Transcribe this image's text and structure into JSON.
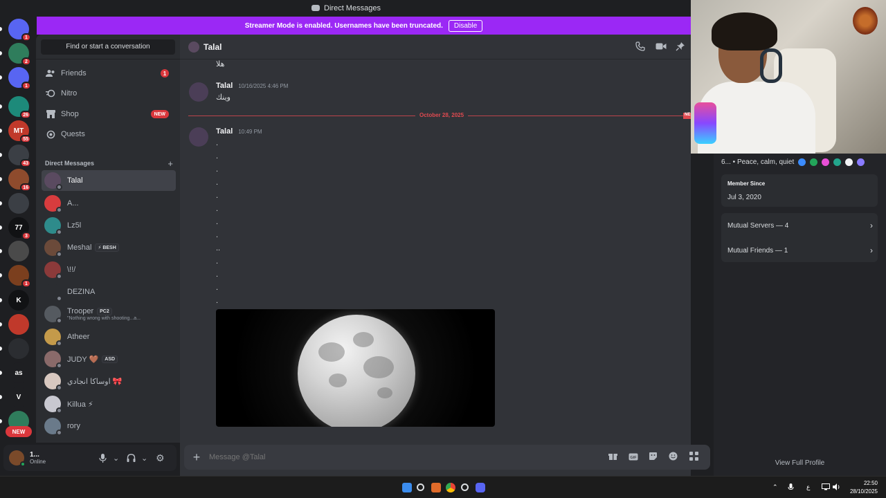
{
  "window": {
    "title": "Direct Messages"
  },
  "banner": {
    "message": "Streamer Mode is enabled. Usernames have been truncated.",
    "disable_label": "Disable"
  },
  "rail": {
    "servers": [
      {
        "label": "",
        "badge": "1",
        "color": "#5865f2",
        "icon": "discord-icon"
      },
      {
        "label": "",
        "badge": "2",
        "color": "#2f7d5c",
        "icon": "leaf-icon"
      },
      {
        "label": "",
        "badge": "1",
        "color": "#5865f2",
        "icon": "discord-icon"
      },
      {
        "label": "",
        "badge": "26",
        "color": "#1d8a7a",
        "icon": "globe-icon"
      },
      {
        "label": "MT",
        "badge": "55",
        "color": "#c0392b",
        "icon": ""
      },
      {
        "label": "",
        "badge": "43",
        "color": "#3b3f45",
        "icon": ""
      },
      {
        "label": "",
        "badge": "16",
        "color": "#8e4b2d",
        "icon": ""
      },
      {
        "label": "",
        "badge": "",
        "color": "#3b3f45",
        "icon": "x-icon"
      },
      {
        "label": "77",
        "badge": "3",
        "color": "#111214",
        "icon": ""
      },
      {
        "label": "",
        "badge": "",
        "color": "#4a4a4a",
        "icon": "spiral-icon"
      },
      {
        "label": "",
        "badge": "1",
        "color": "#7b3f1e",
        "icon": ""
      },
      {
        "label": "K",
        "badge": "",
        "color": "#111214",
        "icon": ""
      },
      {
        "label": "",
        "badge": "",
        "color": "#c0392b",
        "icon": ""
      },
      {
        "label": "",
        "badge": "",
        "color": "#2b2d31",
        "icon": ""
      },
      {
        "label": "as",
        "badge": "",
        "color": "#1e1f22",
        "icon": ""
      },
      {
        "label": "V",
        "badge": "",
        "color": "#1e1f22",
        "icon": ""
      },
      {
        "label": "",
        "badge": "",
        "color": "#2f7d5c",
        "icon": "leaf-icon"
      }
    ],
    "new_label": "NEW"
  },
  "sidebar": {
    "search_placeholder": "Find or start a conversation",
    "nav": [
      {
        "label": "Friends",
        "badge": "1",
        "icon": "friends-icon"
      },
      {
        "label": "Nitro",
        "badge": "",
        "icon": "nitro-icon"
      },
      {
        "label": "Shop",
        "badge": "NEW",
        "icon": "shop-icon"
      },
      {
        "label": "Quests",
        "badge": "",
        "icon": "quests-icon"
      }
    ],
    "dm_header": "Direct Messages",
    "dms": [
      {
        "name": "Talal",
        "sub": "",
        "tag": "",
        "color": "#5a4a60",
        "active": true
      },
      {
        "name": "A...",
        "sub": "",
        "tag": "",
        "color": "#d83c3e",
        "active": false
      },
      {
        "name": "Lz5l",
        "sub": "",
        "tag": "",
        "color": "#2e8b8b",
        "active": false
      },
      {
        "name": "Meshal",
        "sub": "",
        "tag": "⚡ BESH",
        "color": "#6b4a3a",
        "active": false
      },
      {
        "name": "\\!!/",
        "sub": "",
        "tag": "",
        "color": "#8b3a3a",
        "active": false
      },
      {
        "name": "DEZINA",
        "sub": "",
        "tag": "",
        "color": "#2b2d31",
        "active": false
      },
      {
        "name": "Trooper",
        "sub": "\"Nothing wrong with shooting...a...",
        "tag": "PC2",
        "color": "#555a60",
        "active": false
      },
      {
        "name": "Atheer",
        "sub": "",
        "tag": "",
        "color": "#c49a4a",
        "active": false
      },
      {
        "name": "JUDY 🤎",
        "sub": "",
        "tag": "ASD",
        "color": "#8a6a6a",
        "active": false
      },
      {
        "name": "اوساكا انجادي 🎀",
        "sub": "",
        "tag": "",
        "color": "#d8c8c0",
        "active": false
      },
      {
        "name": "Killua ⚡",
        "sub": "",
        "tag": "",
        "color": "#c8c8d0",
        "active": false
      },
      {
        "name": "rory",
        "sub": "",
        "tag": "",
        "color": "#6a7a8a",
        "active": false
      }
    ]
  },
  "user_panel": {
    "name": "1...",
    "status": "Online"
  },
  "chat": {
    "recipient": "Talal",
    "messages": [
      {
        "author": "Talal",
        "time": "10/16/2025 4:46 PM",
        "text": "وينك"
      }
    ],
    "prev_text": "هلا",
    "divider_date": "October 28, 2025",
    "divider_new": "NE",
    "last_author": "Talal",
    "last_time": "10:49 PM",
    "dots": [
      ".",
      ".",
      ".",
      ".",
      ".",
      ".",
      ".",
      ".",
      "..",
      ".",
      ".",
      ".",
      "."
    ],
    "composer_placeholder": "Message @Talal"
  },
  "profile": {
    "bio": "6... • Peace, calm, quiet",
    "member_since_label": "Member Since",
    "member_since": "Jul 3, 2020",
    "mutual_servers": "Mutual Servers — 4",
    "mutual_friends": "Mutual Friends — 1",
    "view_full": "View Full Profile",
    "badge_colors": [
      "#3b8cff",
      "#23a55a",
      "#e84fd6",
      "#23a58c",
      "#f2f3f5",
      "#8a7bff"
    ]
  },
  "taskbar": {
    "time": "22:50",
    "date": "28/10/2025",
    "lang": "ع"
  }
}
